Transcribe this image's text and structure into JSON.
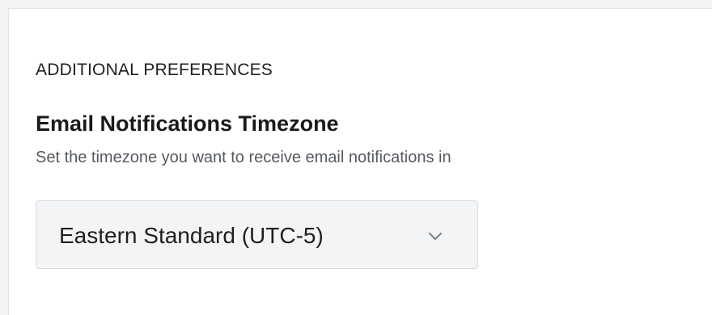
{
  "section": {
    "heading": "ADDITIONAL PREFERENCES"
  },
  "timezone_field": {
    "title": "Email Notifications Timezone",
    "help_text": "Set the timezone you want to receive email notifications in",
    "selected_value": "Eastern Standard (UTC-5)",
    "icon": "chevron-down-icon"
  }
}
